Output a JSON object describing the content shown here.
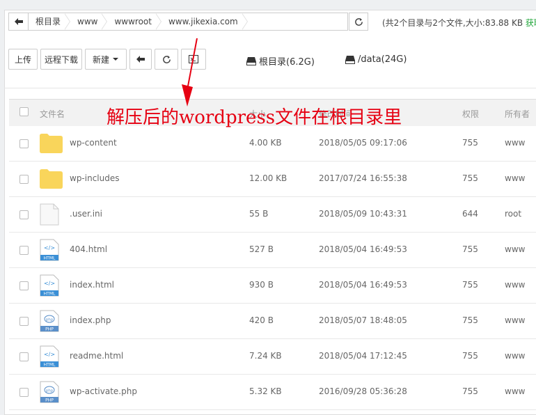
{
  "breadcrumbs": [
    "根目录",
    "www",
    "wwwroot",
    "www.jikexia.com"
  ],
  "summary": {
    "text": "(共2个目录与2个文件,大小:",
    "size": "83.88 KB",
    "link": "获取"
  },
  "toolbar": {
    "upload": "上传",
    "remote_download": "远程下载",
    "new": "新建"
  },
  "disks": [
    {
      "label": "根目录(6.2G)"
    },
    {
      "label": "/data(24G)"
    }
  ],
  "table": {
    "headers": {
      "name": "文件名",
      "size": "大小",
      "mtime": "修改时间",
      "perm": "权限",
      "owner": "所有者"
    },
    "rows": [
      {
        "name": "wp-content",
        "size": "4.00 KB",
        "mtime": "2018/05/05 09:17:06",
        "perm": "755",
        "owner": "www",
        "icon": "folder-icon"
      },
      {
        "name": "wp-includes",
        "size": "12.00 KB",
        "mtime": "2017/07/24 16:55:38",
        "perm": "755",
        "owner": "www",
        "icon": "folder-icon"
      },
      {
        "name": ".user.ini",
        "size": "55 B",
        "mtime": "2018/05/09 10:43:31",
        "perm": "644",
        "owner": "root",
        "icon": "blank-file-icon"
      },
      {
        "name": "404.html",
        "size": "527 B",
        "mtime": "2018/05/04 16:49:53",
        "perm": "755",
        "owner": "www",
        "icon": "html-file-icon"
      },
      {
        "name": "index.html",
        "size": "930 B",
        "mtime": "2018/05/04 16:49:53",
        "perm": "755",
        "owner": "www",
        "icon": "html-file-icon"
      },
      {
        "name": "index.php",
        "size": "420 B",
        "mtime": "2018/05/07 18:48:05",
        "perm": "755",
        "owner": "www",
        "icon": "php-file-icon"
      },
      {
        "name": "readme.html",
        "size": "7.24 KB",
        "mtime": "2018/05/04 17:12:45",
        "perm": "755",
        "owner": "www",
        "icon": "html-file-icon"
      },
      {
        "name": "wp-activate.php",
        "size": "5.32 KB",
        "mtime": "2016/09/28 05:36:28",
        "perm": "755",
        "owner": "www",
        "icon": "php-file-icon"
      }
    ]
  },
  "icon_labels": {
    "html": "HTML",
    "php": "PHP",
    "php_glyph": "php",
    "html_glyph": "</>"
  },
  "annotation": "解压后的wordpress文件在根目录里",
  "colors": {
    "folder": "#f9d55b",
    "html_badge": "#3a8fd6",
    "php_badge": "#5a8fc9",
    "annotation": "#e60012",
    "accent_green": "#20a53a"
  }
}
